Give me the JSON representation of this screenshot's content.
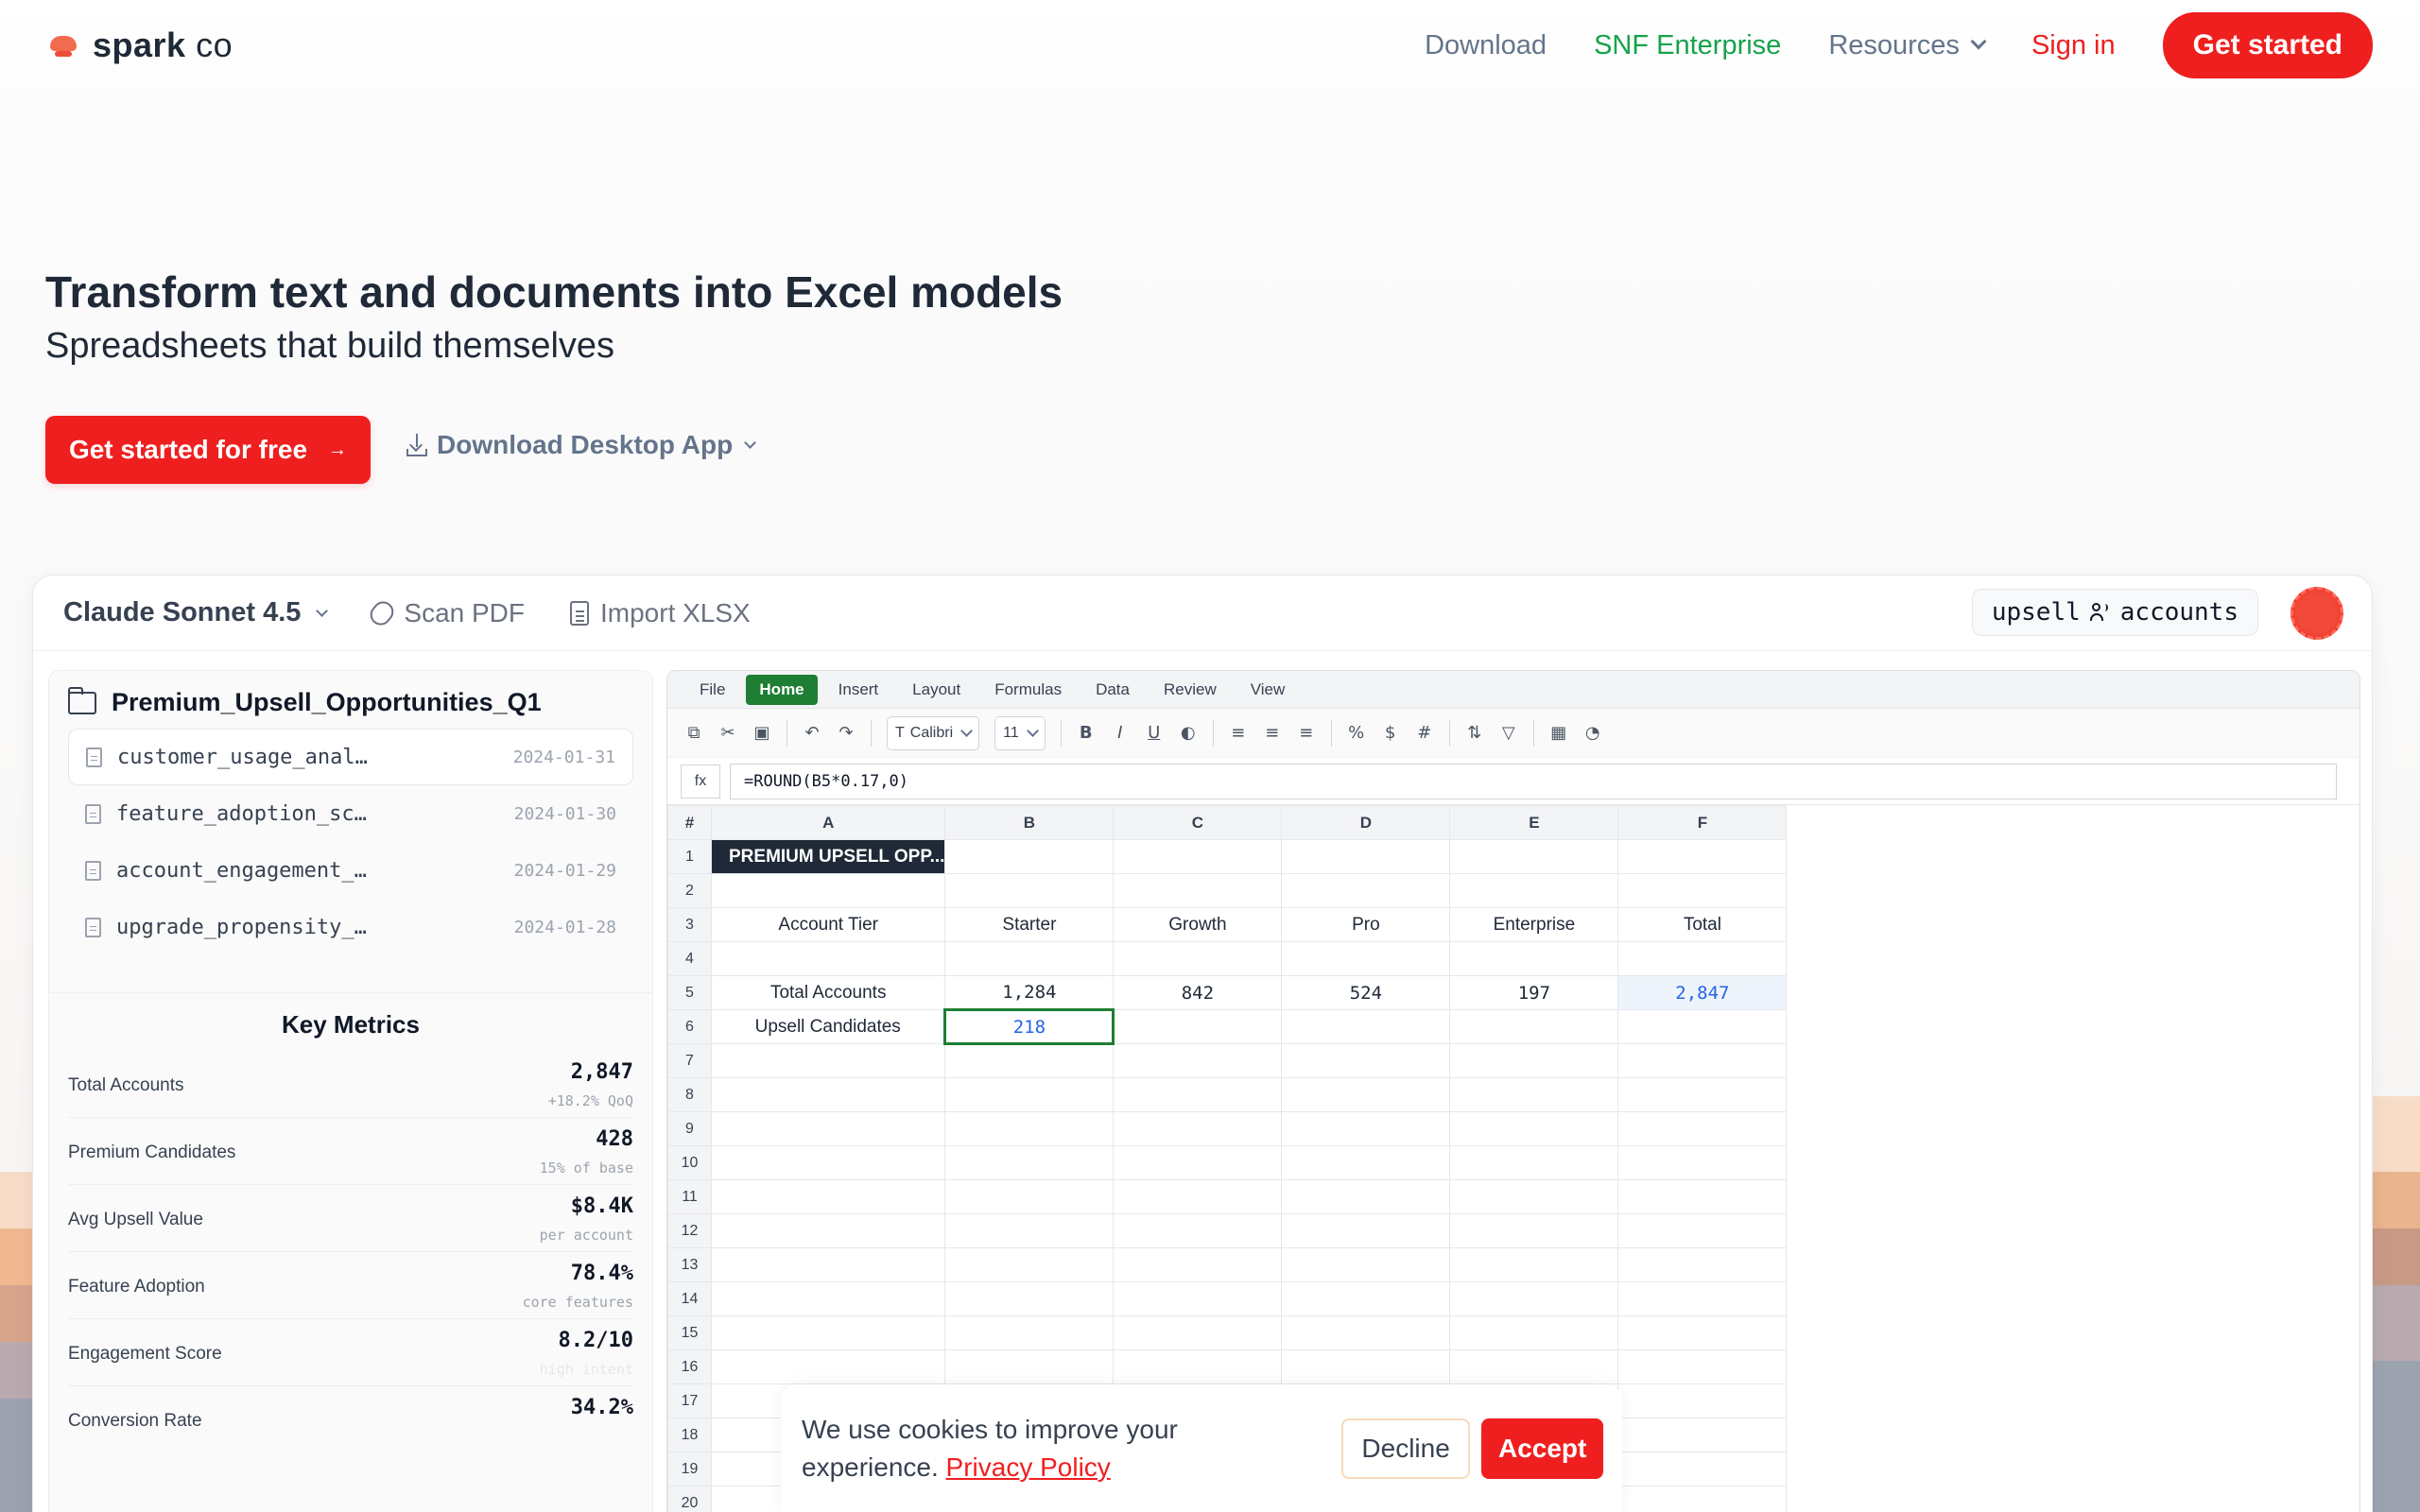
{
  "nav": {
    "logo_main": "spark",
    "logo_suffix": "co",
    "links": {
      "download": "Download",
      "enterprise": "SNF Enterprise",
      "resources": "Resources",
      "signin": "Sign in"
    },
    "cta": "Get started"
  },
  "hero": {
    "title": "Transform text and documents into Excel models",
    "subtitle": "Spreadsheets that build themselves",
    "primary_cta": "Get started for free",
    "primary_cta_arrow": "→",
    "download_label": "Download Desktop App"
  },
  "app": {
    "model": "Claude Sonnet 4.5",
    "scan_pdf": "Scan PDF",
    "import_xlsx": "Import XLSX",
    "tag_left": "upsell",
    "tag_right": "accounts"
  },
  "files": {
    "folder": "Premium_Upsell_Opportunities_Q1",
    "items": [
      {
        "name": "customer_usage_anal…",
        "date": "2024-01-31"
      },
      {
        "name": "feature_adoption_sc…",
        "date": "2024-01-30"
      },
      {
        "name": "account_engagement_…",
        "date": "2024-01-29"
      },
      {
        "name": "upgrade_propensity_…",
        "date": "2024-01-28"
      }
    ]
  },
  "metrics": {
    "title": "Key Metrics",
    "rows": [
      {
        "label": "Total Accounts",
        "value": "2,847",
        "sub": "+18.2% QoQ"
      },
      {
        "label": "Premium Candidates",
        "value": "428",
        "sub": "15% of base"
      },
      {
        "label": "Avg Upsell Value",
        "value": "$8.4K",
        "sub": "per account"
      },
      {
        "label": "Feature Adoption",
        "value": "78.4%",
        "sub": "core features"
      },
      {
        "label": "Engagement Score",
        "value": "8.2/10",
        "sub": "high intent"
      },
      {
        "label": "Conversion Rate",
        "value": "34.2%",
        "sub": ""
      }
    ]
  },
  "sheet": {
    "tabs": [
      "File",
      "Home",
      "Insert",
      "Layout",
      "Formulas",
      "Data",
      "Review",
      "View"
    ],
    "font": "Calibri",
    "font_size": "11",
    "fx_label": "fx",
    "formula": "=ROUND(B5*0.17,0)",
    "corner": "#",
    "columns": [
      "A",
      "B",
      "C",
      "D",
      "E",
      "F"
    ],
    "title_cell": "PREMIUM UPSELL OPP...",
    "header_row": [
      "Account Tier",
      "Starter",
      "Growth",
      "Pro",
      "Enterprise",
      "Total"
    ],
    "row5": [
      "Total Accounts",
      "1,284",
      "842",
      "524",
      "197",
      "2,847"
    ],
    "row6": [
      "Upsell Candidates",
      "218",
      "",
      "",
      "",
      ""
    ],
    "row_numbers": [
      "1",
      "2",
      "3",
      "4",
      "5",
      "6",
      "7",
      "8",
      "9",
      "10",
      "11",
      "12",
      "13",
      "14",
      "15",
      "16",
      "17",
      "18",
      "19",
      "20"
    ]
  },
  "cookie": {
    "text": "We use cookies to improve your experience.",
    "link": "Privacy Policy",
    "decline": "Decline",
    "accept": "Accept"
  },
  "colors": {
    "brand_red": "#ef1f1f",
    "enterprise_green": "#16a34a",
    "sheet_green": "#1e7e34"
  }
}
